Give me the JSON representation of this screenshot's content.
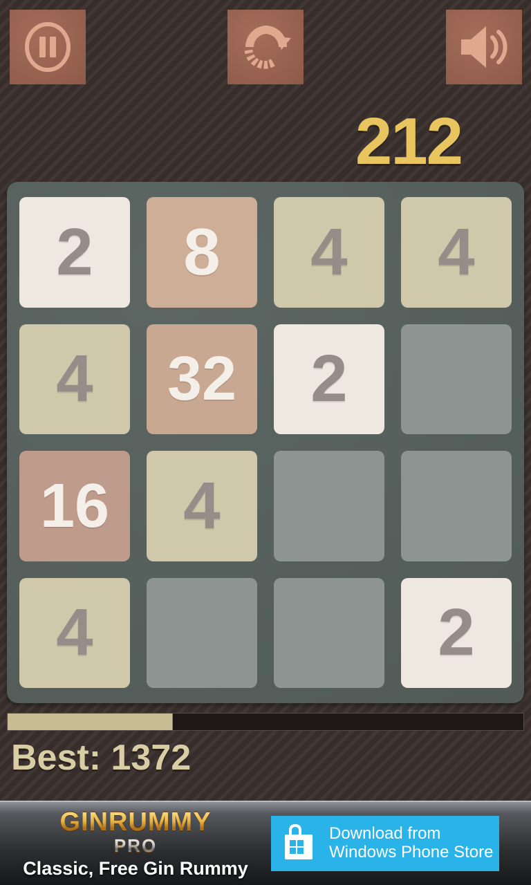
{
  "toolbar": {
    "buttons": [
      {
        "name": "pause-button",
        "icon": "pause-icon",
        "label": "Pause"
      },
      {
        "name": "restart-button",
        "icon": "restart-circular-arrow-icon",
        "label": "Restart"
      },
      {
        "name": "sound-button",
        "icon": "speaker-volume-icon",
        "label": "Sound"
      }
    ]
  },
  "score": {
    "value": "212",
    "color": "#e8c55e"
  },
  "board": {
    "background_color": "#56605c",
    "empty_cell_color": "#8e9492",
    "tiles": [
      {
        "value": "2",
        "bg": "#efe8e1",
        "fg": "#968d88"
      },
      {
        "value": "8",
        "bg": "#ceae97",
        "fg": "#f4efe8"
      },
      {
        "value": "4",
        "bg": "#cfc8ab",
        "fg": "#968d88"
      },
      {
        "value": "4",
        "bg": "#cfc8ab",
        "fg": "#968d88"
      },
      {
        "value": "4",
        "bg": "#cfc8ab",
        "fg": "#968d88"
      },
      {
        "value": "32",
        "bg": "#c9a891",
        "fg": "#f4efe8"
      },
      {
        "value": "2",
        "bg": "#efe8e1",
        "fg": "#968d88"
      },
      {
        "value": "",
        "bg": "#8e9492",
        "fg": ""
      },
      {
        "value": "16",
        "bg": "#bf9b8c",
        "fg": "#f4efe8"
      },
      {
        "value": "4",
        "bg": "#cfc8ab",
        "fg": "#968d88"
      },
      {
        "value": "",
        "bg": "#8e9492",
        "fg": ""
      },
      {
        "value": "",
        "bg": "#8e9492",
        "fg": ""
      },
      {
        "value": "4",
        "bg": "#cfc8ab",
        "fg": "#968d88"
      },
      {
        "value": "",
        "bg": "#8e9492",
        "fg": ""
      },
      {
        "value": "",
        "bg": "#8e9492",
        "fg": ""
      },
      {
        "value": "2",
        "bg": "#efe8e1",
        "fg": "#968d88"
      }
    ]
  },
  "progress": {
    "percent": 32,
    "fill_color": "#c8bd92",
    "track_color": "#1d1715"
  },
  "best": {
    "text": "Best: 1372",
    "color": "#d8cda4"
  },
  "ad": {
    "logo_line1": "GINRUMMY",
    "logo_line2": "PRO",
    "tagline": "Classic, Free Gin Rummy",
    "store_line1": "Download from",
    "store_line2": "Windows Phone Store",
    "store_icon": "windows-store-bag-icon",
    "store_color": "#29b3e8"
  }
}
